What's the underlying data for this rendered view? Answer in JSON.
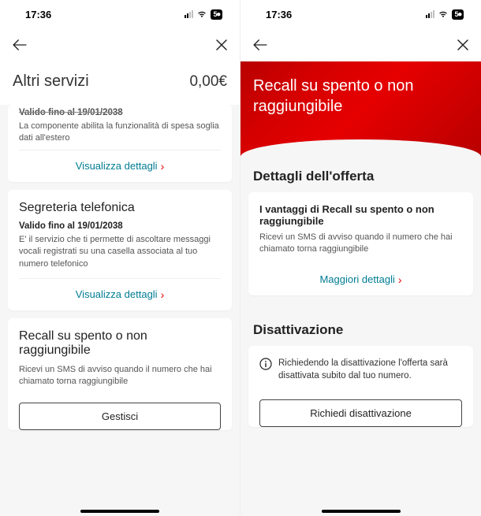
{
  "status": {
    "time": "17:36",
    "network_badge": "5⏺"
  },
  "left": {
    "title": "Altri servizi",
    "amount": "0,00€",
    "card1": {
      "trunc_title": "Valido fino al 19/01/2038",
      "desc": "La componente abilita la funzionalità di spesa soglia dati all'estero",
      "link": "Visualizza dettagli"
    },
    "card2": {
      "title": "Segreteria telefonica",
      "sub": "Valido fino al 19/01/2038",
      "desc": "E' il servizio che ti permette di ascoltare messaggi vocali registrati su una casella associata al tuo numero telefonico",
      "link": "Visualizza dettagli"
    },
    "card3": {
      "title": "Recall su spento o non raggiungibile",
      "desc": "Ricevi un SMS di avviso quando il numero che hai chiamato torna raggiungibile",
      "button": "Gestisci"
    }
  },
  "right": {
    "hero_title": "Recall su spento o non raggiungibile",
    "section1": "Dettagli dell'offerta",
    "card1": {
      "title": "I vantaggi di Recall su spento o non raggiungibile",
      "desc": "Ricevi un SMS di avviso quando il numero che hai chiamato torna raggiungibile",
      "link": "Maggiori dettagli"
    },
    "section2": "Disattivazione",
    "card2": {
      "info": "Richiedendo la disattivazione l'offerta sarà disattivata subito dal tuo numero.",
      "button": "Richiedi disattivazione"
    }
  }
}
